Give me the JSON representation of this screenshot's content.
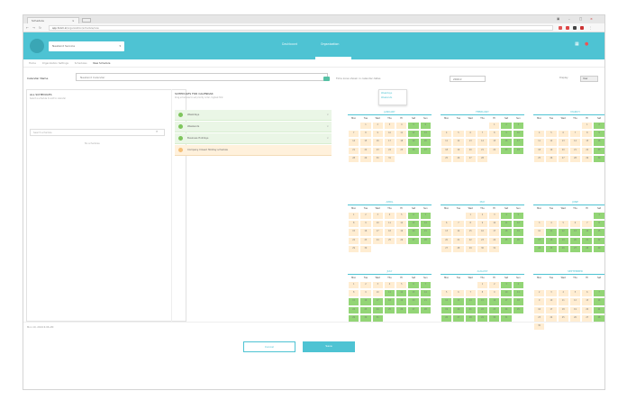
{
  "browser": {
    "tab_title": "Schedule",
    "url_domain": "app.hcom.io",
    "url_path": "/organization/schedule/new"
  },
  "header": {
    "org_selector": "Newland Service",
    "tabs": [
      {
        "label": "Dashboard",
        "active": false
      },
      {
        "label": "Organization",
        "active": true
      }
    ],
    "accent_color": "#4ec3d3"
  },
  "breadcrumb": [
    "Home",
    "Organization Settings",
    "Schedules",
    "New Schedule"
  ],
  "form": {
    "calendar_name_label": "Calendar Name",
    "calendar_name_value": "Newland Calendar"
  },
  "left_panel": {
    "title": "ALL SCHEDULES",
    "subtitle": "Select a schedule to add to calendar",
    "search_placeholder": "Search schedule",
    "no_results": "No schedules"
  },
  "mid_panel": {
    "title": "SCHEDULES FOR CALENDAR",
    "subtitle": "Drag schedules to set priority order, highest first",
    "items": [
      {
        "label": "Weekdays",
        "color": "green"
      },
      {
        "label": "Weekends",
        "color": "green"
      },
      {
        "label": "Business Holidays",
        "color": "green"
      },
      {
        "label": "Company Closed Holiday schedule",
        "color": "orange"
      }
    ]
  },
  "calendar": {
    "tz_label": "Time zone shown in calendar dates",
    "year_select": "2019",
    "view_label": "Display",
    "view_select": "Year",
    "popup": [
      "Weekdays",
      "Weekends"
    ],
    "weekdays": [
      "Mon",
      "Tue",
      "Wed",
      "Thu",
      "Fri",
      "Sat",
      "Sun"
    ],
    "months": [
      {
        "name": "JANUARY",
        "start": 1,
        "days": 31,
        "green": "weekend"
      },
      {
        "name": "FEBRUARY",
        "start": 4,
        "days": 28,
        "green": "weekend"
      },
      {
        "name": "MARCH",
        "start": 4,
        "days": 31,
        "green": "weekend"
      },
      {
        "name": "APRIL",
        "start": 0,
        "days": 30,
        "green": "weekend"
      },
      {
        "name": "MAY",
        "start": 2,
        "days": 31,
        "green": "weekend"
      },
      {
        "name": "JUNE",
        "start": 5,
        "days": 30,
        "green": "most"
      },
      {
        "name": "JULY",
        "start": 0,
        "days": 31,
        "green": "most"
      },
      {
        "name": "AUGUST",
        "start": 3,
        "days": 31,
        "green": "most"
      },
      {
        "name": "SEPTEMBER",
        "start": 6,
        "days": 30,
        "green": "weekend"
      }
    ]
  },
  "footer": {
    "status": "Mon 10, 2019 6:06 AM",
    "cancel": "Cancel",
    "save": "Save"
  }
}
